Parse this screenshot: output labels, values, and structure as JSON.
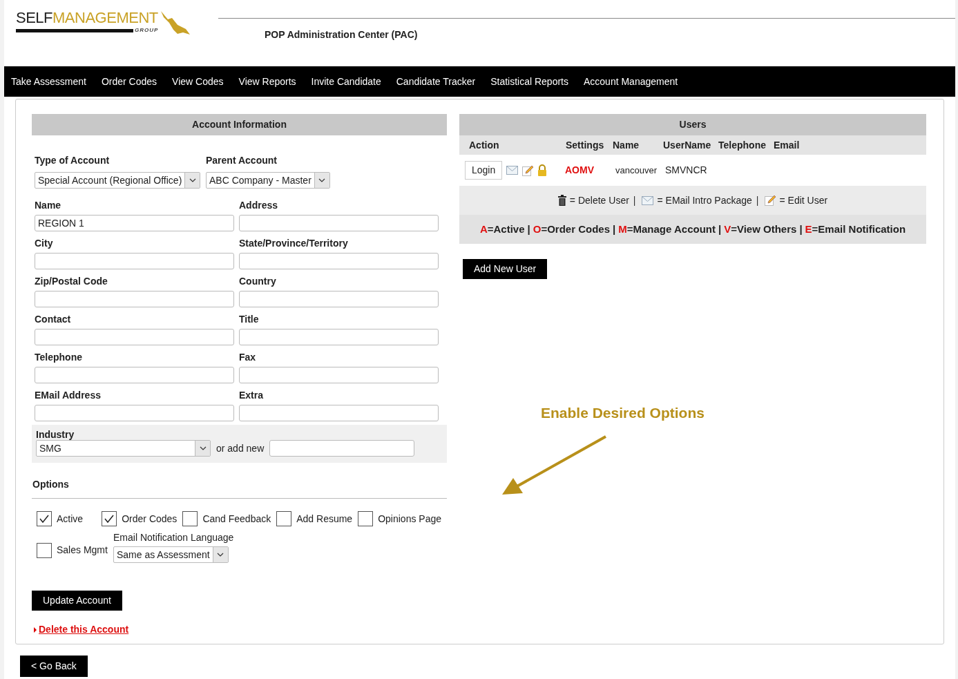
{
  "logo": {
    "first": "SELF",
    "second": "MANAGEMENT",
    "sub": "GROUP"
  },
  "header": {
    "title": "POP Administration Center (PAC)"
  },
  "nav": [
    "Take Assessment",
    "Order Codes",
    "View Codes",
    "View Reports",
    "Invite Candidate",
    "Candidate Tracker",
    "Statistical Reports",
    "Account Management"
  ],
  "account": {
    "title": "Account Information",
    "selects": [
      {
        "label": "Type of Account",
        "value": "Special Account (Regional Office)"
      },
      {
        "label": "Parent Account",
        "value": "ABC Company - Master"
      }
    ],
    "fields": [
      {
        "label": "Name",
        "value": "REGION 1"
      },
      {
        "label": "Address"
      },
      {
        "label": "City"
      },
      {
        "label": "State/Province/Territory"
      },
      {
        "label": "Zip/Postal Code"
      },
      {
        "label": "Country"
      },
      {
        "label": "Contact"
      },
      {
        "label": "Title"
      },
      {
        "label": "Telephone"
      },
      {
        "label": "Fax"
      },
      {
        "label": "EMail Address"
      },
      {
        "label": "Extra"
      }
    ],
    "industry": {
      "label": "Industry",
      "value": "SMG",
      "add_label": "or add new"
    },
    "options_title": "Options",
    "options": [
      {
        "label": "Active",
        "checked": true
      },
      {
        "label": "Order Codes",
        "checked": true
      },
      {
        "label": "Cand Feedback",
        "checked": false
      },
      {
        "label": "Add Resume",
        "checked": false
      },
      {
        "label": "Opinions Page",
        "checked": false
      },
      {
        "label": "Sales Mgmt",
        "checked": false
      }
    ],
    "language": {
      "label": "Email Notification Language",
      "value": "Same as Assessment"
    },
    "update_button": "Update Account",
    "delete_link": "Delete this Account"
  },
  "users": {
    "title": "Users",
    "columns": [
      "Action",
      "Settings",
      "Name",
      "UserName",
      "Telephone",
      "Email"
    ],
    "rows": [
      {
        "login": "Login",
        "settings": "AOMV",
        "name": "vancouver",
        "username": "SMVNCR"
      }
    ],
    "icon_legend": [
      {
        "kind": "trash",
        "label": "= Delete User"
      },
      {
        "kind": "mail",
        "label": "= EMail Intro Package",
        "separator": "|"
      },
      {
        "kind": "edit",
        "label": "= Edit User",
        "separator": "|"
      }
    ],
    "settings_legend": [
      {
        "key": "A",
        "label": "=Active"
      },
      {
        "key": "O",
        "label": "=Order Codes",
        "separator": "|"
      },
      {
        "key": "M",
        "label": "=Manage Account",
        "separator": "|"
      },
      {
        "key": "V",
        "label": "=View Others",
        "separator": "|"
      },
      {
        "key": "E",
        "label": "=Email Notification",
        "separator": "|"
      }
    ],
    "add_button": "Add New User"
  },
  "annotation": "Enable Desired Options",
  "back_button": "< Go Back"
}
